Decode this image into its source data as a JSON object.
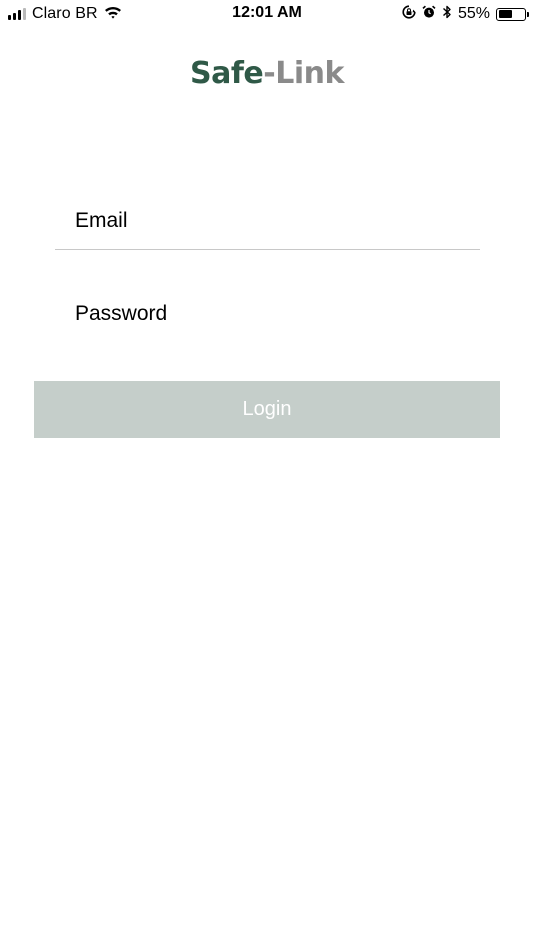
{
  "status_bar": {
    "carrier": "Claro BR",
    "time": "12:01 AM",
    "battery_percent_label": "55%",
    "battery_level": 0.55,
    "signal_bars_filled": 3,
    "signal_bars_total": 4,
    "icons": [
      "signal-icon",
      "wifi-icon",
      "orientation-lock-icon",
      "alarm-icon",
      "bluetooth-icon",
      "battery-icon"
    ]
  },
  "logo": {
    "part1": "Safe",
    "part2": "-Link",
    "colors": {
      "safe": "#2f5947",
      "link": "#8a8a8a"
    }
  },
  "form": {
    "email": {
      "placeholder": "Email",
      "value": ""
    },
    "password": {
      "placeholder": "Password",
      "value": ""
    },
    "login_label": "Login",
    "login_button_color": "#c5ceca"
  }
}
